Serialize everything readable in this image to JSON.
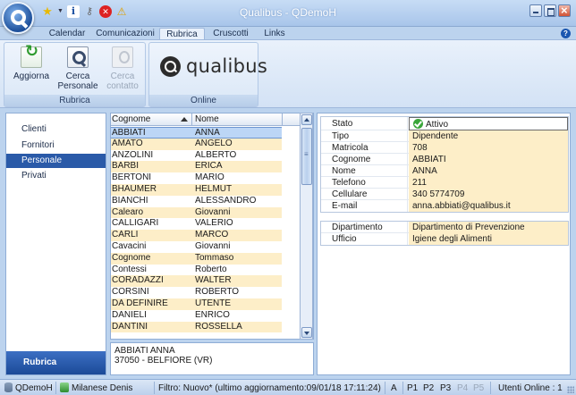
{
  "window": {
    "title": "Qualibus  -  QDemoH"
  },
  "ribbon_tabs": [
    "Calendar",
    "Comunicazioni",
    "Rubrica",
    "Cruscotti",
    "Links"
  ],
  "ribbon": {
    "group_rubrica": {
      "label": "Rubrica",
      "aggiorna": "Aggiorna",
      "cerca_personale_1": "Cerca",
      "cerca_personale_2": "Personale",
      "cerca_contatto_1": "Cerca",
      "cerca_contatto_2": "contatto"
    },
    "group_online": {
      "label": "Online",
      "logo_text": "qualibus"
    }
  },
  "nav": {
    "items": [
      "Clienti",
      "Fornitori",
      "Personale",
      "Privati"
    ],
    "selected": "Personale",
    "footer": "Rubrica"
  },
  "grid": {
    "headers": {
      "cognome": "Cognome",
      "nome": "Nome"
    },
    "rows": [
      [
        "ABBIATI",
        "ANNA"
      ],
      [
        "AMATO",
        "ANGELO"
      ],
      [
        "ANZOLINI",
        "ALBERTO"
      ],
      [
        "BARBI",
        "ERICA"
      ],
      [
        "BERTONI",
        "MARIO"
      ],
      [
        "BHAUMER",
        "HELMUT"
      ],
      [
        "BIANCHI",
        "ALESSANDRO"
      ],
      [
        "Calearo",
        "Giovanni"
      ],
      [
        "CALLIGARI",
        "VALERIO"
      ],
      [
        "CARLI",
        "MARCO"
      ],
      [
        "Cavacini",
        "Giovanni"
      ],
      [
        "Cognome",
        "Tommaso"
      ],
      [
        "Contessi",
        "Roberto"
      ],
      [
        "CORADAZZI",
        "WALTER"
      ],
      [
        "CORSINI",
        "ROBERTO"
      ],
      [
        "DA DEFINIRE",
        "UTENTE"
      ],
      [
        "DANIELI",
        "ENRICO"
      ],
      [
        "DANTINI",
        "ROSSELLA"
      ]
    ]
  },
  "address": {
    "line1": "ABBIATI ANNA",
    "line2": "37050 - BELFIORE (VR)"
  },
  "detail": {
    "stato_label": "Stato",
    "stato_value": "Attivo",
    "fields": [
      [
        "Tipo",
        "Dipendente"
      ],
      [
        "Matricola",
        "708"
      ],
      [
        "Cognome",
        "ABBIATI"
      ],
      [
        "Nome",
        "ANNA"
      ],
      [
        "Telefono",
        "211"
      ],
      [
        "Cellulare",
        "340 5774709"
      ],
      [
        "E-mail",
        "anna.abbiati@qualibus.it"
      ]
    ],
    "fields2": [
      [
        "Dipartimento",
        "Dipartimento di Prevenzione"
      ],
      [
        "Ufficio",
        "Igiene degli Alimenti"
      ]
    ]
  },
  "status": {
    "db": "QDemoH",
    "user": "Milanese Denis",
    "filter": "Filtro: Nuovo*  (ultimo aggiornamento:09/01/18 17:11:24)",
    "a": "A",
    "p1": "P1",
    "p2": "P2",
    "p3": "P3",
    "p4": "P4",
    "p5": "P5",
    "online": "Utenti Online : 1"
  }
}
